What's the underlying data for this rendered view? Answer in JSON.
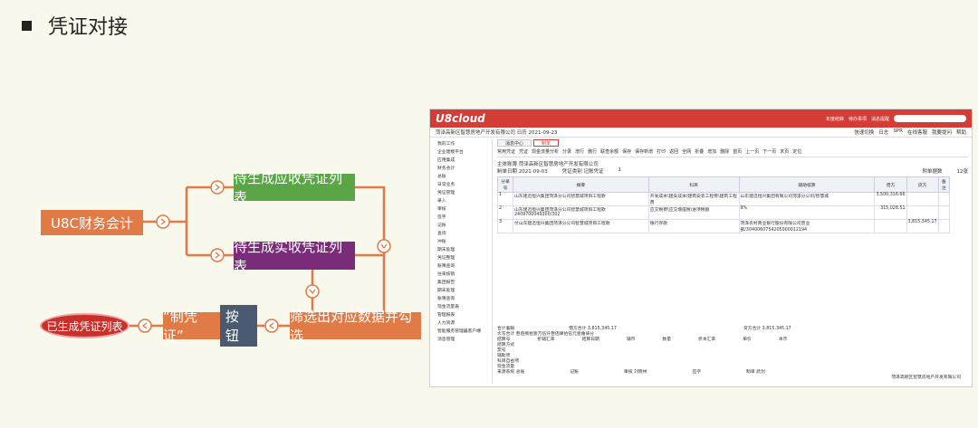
{
  "title": "凭证对接",
  "nodes": {
    "source": "U8C财务会计",
    "receivable": "待生成应收凭证列表",
    "received": "待生成实收凭证列表",
    "filter": "筛选出对应数据并勾选",
    "make_voucher": "“制凭证”",
    "button": "按钮",
    "result": "已生成凭证列表"
  },
  "colors": {
    "orange": "#e07a47",
    "green": "#5aa646",
    "purple": "#7a2b7a",
    "red": "#c9302c",
    "u8_red": "#d43c35"
  },
  "u8": {
    "logo": "U8cloud",
    "top_links": [
      "年度结转",
      "待办事项",
      "消息提醒"
    ],
    "org": "菏泽高新区智慧房地产开发有限公司",
    "date": "日历 2021-09-23",
    "right_tools": [
      "快速切换",
      "日志",
      "SPR",
      "在线客服",
      "我要提问",
      "帮助"
    ],
    "sidebar": [
      "我的工作",
      "企业建模平台",
      "应用集成",
      "财务会计",
      "总账",
      "日常业务",
      "凭证管理",
      "录入",
      "审核",
      "签字",
      "记账",
      "查询",
      "冲账",
      "期末处理",
      "凭证整理",
      "账簿查询",
      "往来核销",
      "集团报告",
      "期末处理",
      "账簿查询",
      "现金流量表",
      "管理报表",
      "人力资源",
      "智能服务管理器客户端",
      "消息管理"
    ],
    "tabs": [
      "消息中心",
      "制单"
    ],
    "toolbar": [
      "常用凭证",
      "凭证",
      "现金流量分析",
      "分录",
      "增行",
      "删行",
      "联查余额",
      "保存",
      "保存新增",
      "打印",
      "返回",
      "全网",
      "折叠",
      "增加",
      "删除",
      "首页",
      "上一页",
      "下一页",
      "末页",
      "定位"
    ],
    "voucher_org": "主体账簿 菏泽高新区智慧房地产开发有限公司",
    "voucher_date": "制单日期 2021-09-03",
    "voucher_type": "凭证类别 记账凭证",
    "voucher_no": "1",
    "attach_label": "附单据数",
    "attach_count": "12张",
    "headers": [
      "分录号",
      "摘要",
      "科目",
      "辅助核算",
      "借方",
      "贷方",
      "备注"
    ],
    "rows": [
      {
        "no": "1",
        "summary": "山东建迅恒兴集团菏泽分公司智慧城项目工程款",
        "subject": "开发成本\\建安成本\\建筑安装工程费\\建筑工程费",
        "aux": "山东建迅恒兴集团有限公司菏泽分公司/智慧城",
        "debit": "3,500,316.66",
        "credit": ""
      },
      {
        "no": "2",
        "summary": "山东建迅恒兴集团菏泽分公司智慧城项目工程款2409700049300/302",
        "subject": "应交税费\\应交增值税\\进项税额",
        "aux": "9%",
        "debit": "315,028.51",
        "credit": ""
      },
      {
        "no": "3",
        "summary": "付山东建迅恒兴集团菏泽分公司智慧城项目工程款",
        "subject": "银行存款",
        "aux": "菏泽农村商业银行股份有限公司营业部/3040060754205000012194",
        "debit": "",
        "credit": "3,815,345.17"
      }
    ],
    "foot": {
      "total": "合计着眼",
      "debit_total": "借方合计 3,815,345.17",
      "credit_total": "贷方合计 3,815,345.17",
      "caps": "大写合计 叁佰捌拾壹万伍仟叁佰肆拾伍元壹角柒分",
      "lines": [
        "结算方式",
        "票号",
        "辅助项",
        "科目自由项",
        "现金流量"
      ],
      "fields": [
        "结算号",
        "折辅汇率",
        "结算日期",
        "辅币",
        "数量",
        "折本汇率",
        "单价",
        "本币"
      ],
      "bottom": [
        "来源系统 总账",
        "记账",
        "审核 刘晓林",
        "签字",
        "制单 武剑"
      ],
      "company": "菏泽高新区智慧房地产开发有限公司"
    }
  }
}
